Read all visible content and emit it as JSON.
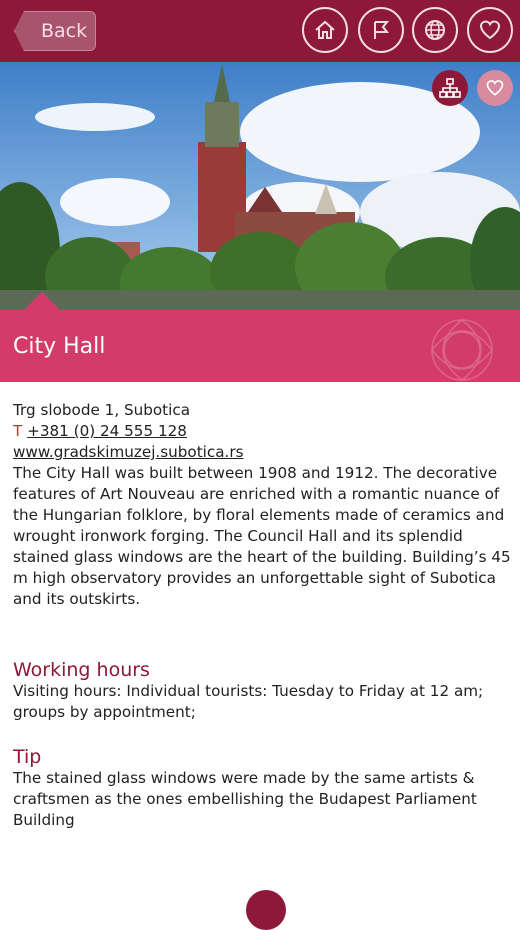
{
  "topbar": {
    "back_label": "Back",
    "color": "#8e1838"
  },
  "nav_icons": [
    "home-icon",
    "flag-icon",
    "globe-icon",
    "heart-icon"
  ],
  "hero": {
    "icons": [
      "sitemap-icon",
      "heart-icon"
    ]
  },
  "place": {
    "title": "City Hall",
    "address": "Trg slobode 1, Subotica",
    "phone_prefix": "T",
    "phone": "+381 (0) 24 555 128",
    "website": "www.gradskimuzej.subotica.rs",
    "description": "The City Hall was built between 1908 and 1912. The decorative features of Art Nouveau are enriched with a romantic nuance of the Hungarian folklore, by floral elements made of ceramics and wrought ironwork forging. The Council Hall and its splendid stained glass windows are the heart of the building. Building’s 45 m high observatory provides an unforgettable sight of Subotica and its outskirts."
  },
  "working_hours": {
    "heading": "Working hours",
    "text": "Visiting hours: Individual tourists: Tuesday to Friday at 12 am; groups by appointment;"
  },
  "tip": {
    "heading": "Tip",
    "text": "The stained glass windows were made by the same artists & craftsmen as the ones embellishing the Budapest Parliament Building"
  },
  "colors": {
    "accent": "#8e1838",
    "title_bar": "#d33b6b"
  }
}
